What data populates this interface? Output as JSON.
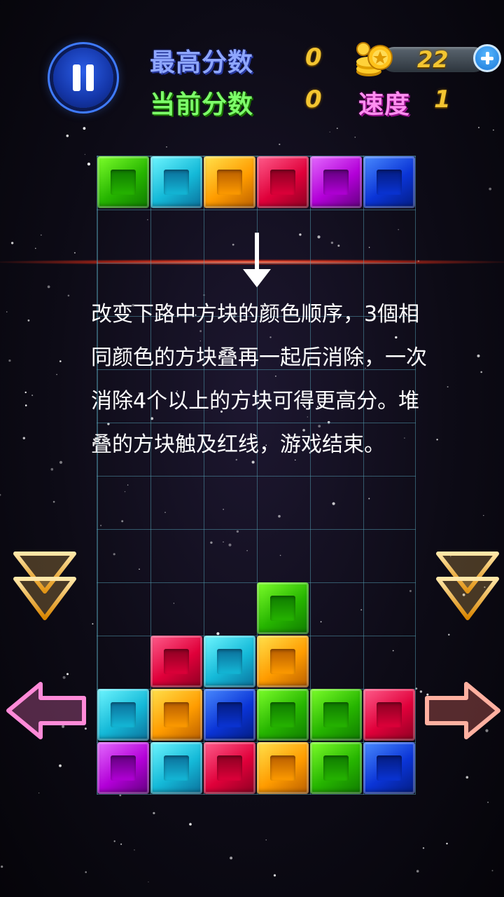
{
  "hud": {
    "high_score_label": "最高分数",
    "high_score_value": "0",
    "current_score_label": "当前分数",
    "current_score_value": "0",
    "coins": "22",
    "speed_label": "速度",
    "speed_value": "1"
  },
  "instructions": "改变下路中方块的颜色顺序，3個相同颜色的方块叠再一起后消除，一次消除4个以上的方块可得更高分。堆叠的方块触及红线，游戏结束。",
  "board": {
    "columns": 6,
    "rows": 12,
    "next_piece": [
      "green",
      "cyan",
      "orange",
      "red",
      "purple",
      "blue"
    ],
    "stack": [
      {
        "col": 3,
        "row": 8,
        "color": "green"
      },
      {
        "col": 1,
        "row": 9,
        "color": "red"
      },
      {
        "col": 2,
        "row": 9,
        "color": "cyan"
      },
      {
        "col": 3,
        "row": 9,
        "color": "orange"
      },
      {
        "col": 0,
        "row": 10,
        "color": "cyan"
      },
      {
        "col": 1,
        "row": 10,
        "color": "orange"
      },
      {
        "col": 2,
        "row": 10,
        "color": "blue"
      },
      {
        "col": 3,
        "row": 10,
        "color": "green"
      },
      {
        "col": 4,
        "row": 10,
        "color": "green"
      },
      {
        "col": 5,
        "row": 10,
        "color": "red"
      },
      {
        "col": 0,
        "row": 11,
        "color": "purple"
      },
      {
        "col": 1,
        "row": 11,
        "color": "cyan"
      },
      {
        "col": 2,
        "row": 11,
        "color": "red"
      },
      {
        "col": 3,
        "row": 11,
        "color": "orange"
      },
      {
        "col": 4,
        "row": 11,
        "color": "green"
      },
      {
        "col": 5,
        "row": 11,
        "color": "blue"
      }
    ]
  },
  "colors": {
    "green": [
      "#7dff2a",
      "#26b500",
      "#0f7a00"
    ],
    "cyan": [
      "#6ff6ff",
      "#14b9d8",
      "#0b6f9a"
    ],
    "orange": [
      "#ffe24d",
      "#ff9c00",
      "#b85d00"
    ],
    "red": [
      "#ff5d8c",
      "#e0003a",
      "#8c0022"
    ],
    "purple": [
      "#e46bff",
      "#b300d8",
      "#62007e"
    ],
    "blue": [
      "#4a8bff",
      "#0a34d6",
      "#041c80"
    ],
    "high_score_label": "#8ea6ff",
    "current_score_label": "#7dff6a",
    "speed_label": "#ff8ef0",
    "digits": "#f3c531"
  }
}
